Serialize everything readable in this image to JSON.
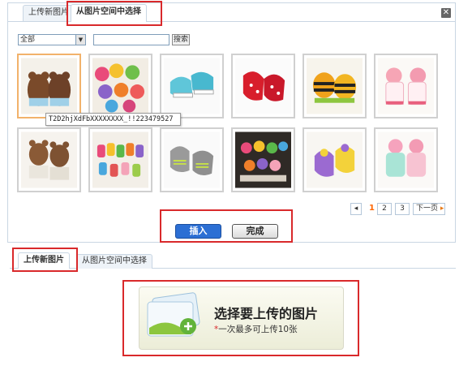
{
  "top_dialog": {
    "tabs": [
      {
        "label": "上传新图片",
        "active": false
      },
      {
        "label": "从图片空间中选择",
        "active": true
      }
    ],
    "close_icon": "close-icon",
    "filter": {
      "selected": "全部"
    },
    "search": {
      "value": "",
      "button_label": "搜索"
    },
    "thumbnails": [
      {
        "alt": "brown bear baby socks",
        "selected": true
      },
      {
        "alt": "assorted animal baby socks"
      },
      {
        "alt": "blue sneaker baby socks"
      },
      {
        "alt": "red polka dot baby socks"
      },
      {
        "alt": "orange bee baby socks"
      },
      {
        "alt": "pink girl baby socks"
      },
      {
        "alt": "bear baby socks white"
      },
      {
        "alt": "assorted baby socks collection"
      },
      {
        "alt": "grey sneaker baby socks"
      },
      {
        "alt": "multiple baby sock set"
      },
      {
        "alt": "purple yellow baby socks"
      },
      {
        "alt": "mint and pink baby socks"
      }
    ],
    "tooltip": "T2D2hjXdFbXXXXXXXX_!!223479527",
    "pagination": {
      "prev_icon": "chevron-left-icon",
      "current": "1",
      "pages": [
        "2",
        "3"
      ],
      "next_label": "下一页"
    },
    "actions": {
      "insert_label": "插入",
      "done_label": "完成"
    },
    "colors": {
      "accent": "#2c6fd4",
      "highlight": "#d9292b",
      "current_page": "#ff6600"
    }
  },
  "bottom": {
    "tabs": [
      {
        "label": "上传新图片",
        "active": true
      },
      {
        "label": "从图片空间中选择",
        "active": false
      }
    ],
    "upload": {
      "title": "选择要上传的图片",
      "note_star": "*",
      "note": "一次最多可上传10张",
      "icon": "image-upload-icon"
    }
  }
}
